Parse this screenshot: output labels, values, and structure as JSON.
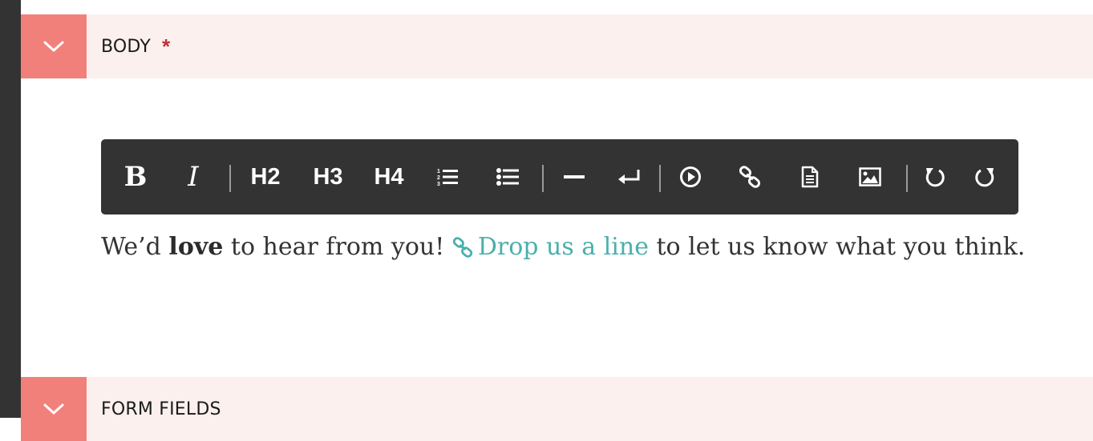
{
  "sections": {
    "body": {
      "title": "BODY",
      "required_mark": "*"
    },
    "form_fields": {
      "title": "FORM FIELDS"
    }
  },
  "toolbar": {
    "bold": "B",
    "italic": "I",
    "h2": "H2",
    "h3": "H3",
    "h4": "H4",
    "icons": [
      "bold",
      "italic",
      "h2",
      "h3",
      "h4",
      "ordered-list-icon",
      "bullet-list-icon",
      "horizontal-rule-icon",
      "line-break-icon",
      "video-icon",
      "link-icon",
      "document-icon",
      "image-icon",
      "undo-icon",
      "redo-icon"
    ]
  },
  "content": {
    "part1": "We’d ",
    "bold": "love",
    "part2": " to hear from you! ",
    "link_text": "Drop us a line",
    "part3": " to let us know what you think."
  },
  "colors": {
    "accent": "#f2807a",
    "header_bg": "#fcf0ef",
    "toolbar_bg": "#333333",
    "link": "#4ab0ab",
    "required": "#c0303a"
  }
}
